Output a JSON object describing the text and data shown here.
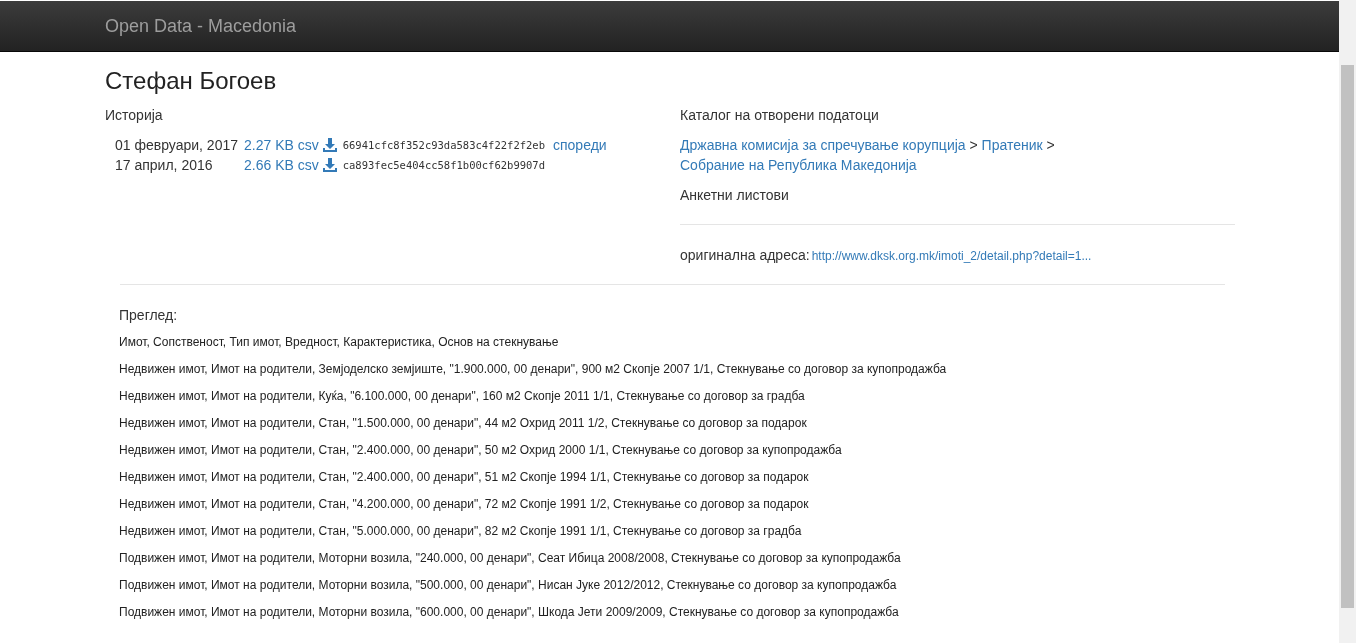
{
  "navbar": {
    "brand": "Open Data - Macedonia"
  },
  "title": "Стефан Богоев",
  "history": {
    "heading": "Историја",
    "rows": [
      {
        "date": "01 февруари, 2017",
        "size": "2.27 KB csv",
        "hash": "66941cfc8f352c93da583c4f22f2f2eb",
        "compare": "спореди"
      },
      {
        "date": "17 април, 2016",
        "size": "2.66 KB csv",
        "hash": "ca893fec5e404cc58f1b00cf62b9907d"
      }
    ]
  },
  "catalog": {
    "heading": "Каталог на отворени податоци",
    "breadcrumb": [
      {
        "kind": "link",
        "text": "Државна комисија за спречување корупција"
      },
      {
        "kind": "separator",
        "text": ">"
      },
      {
        "kind": "link",
        "text": "Пратеник"
      },
      {
        "kind": "separator",
        "text": ">"
      },
      {
        "kind": "link",
        "text": "Собрание на Република Македонија"
      }
    ],
    "category": "Анкетни листови",
    "source_label": "оригинална адреса:",
    "source_url": "http://www.dksk.org.mk/imoti_2/detail.php?detail=1..."
  },
  "preview": {
    "heading": "Преглед:",
    "lines": [
      "Имот, Сопственост, Тип имот, Вредност, Карактеристика, Основ на стекнување",
      "Недвижен имот, Имот на родители, Земјоделско земјиште, \"1.900.000, 00 денари\", 900 м2 Скопје 2007 1/1, Стекнување со договор за купопродажба",
      "Недвижен имот, Имот на родители, Куќа, \"6.100.000, 00 денари\", 160 м2 Скопје 2011 1/1, Стекнување со договор за градба",
      "Недвижен имот, Имот на родители, Стан, \"1.500.000, 00 денари\", 44 м2 Охрид 2011 1/2, Стекнување со договор за подарок",
      "Недвижен имот, Имот на родители, Стан, \"2.400.000, 00 денари\", 50 м2 Охрид 2000 1/1, Стекнување со договор за купопродажба",
      "Недвижен имот, Имот на родители, Стан, \"2.400.000, 00 денари\", 51 м2 Скопје 1994 1/1, Стекнување со договор за подарок",
      "Недвижен имот, Имот на родители, Стан, \"4.200.000, 00 денари\", 72 м2 Скопје 1991 1/2, Стекнување со договор за подарок",
      "Недвижен имот, Имот на родители, Стан, \"5.000.000, 00 денари\", 82 м2 Скопје 1991 1/1, Стекнување со договор за градба",
      "Подвижен имот, Имот на родители, Моторни возила, \"240.000, 00 денари\", Сеат Ибица 2008/2008, Стекнување со договор за купопродажба",
      "Подвижен имот, Имот на родители, Моторни возила, \"500.000, 00 денари\", Нисан Јуке 2012/2012, Стекнување со договор за купопродажба",
      "Подвижен имот, Имот на родители, Моторни возила, \"600.000, 00 денари\", Шкода Јети 2009/2009, Стекнување со договор за купопродажба"
    ]
  }
}
